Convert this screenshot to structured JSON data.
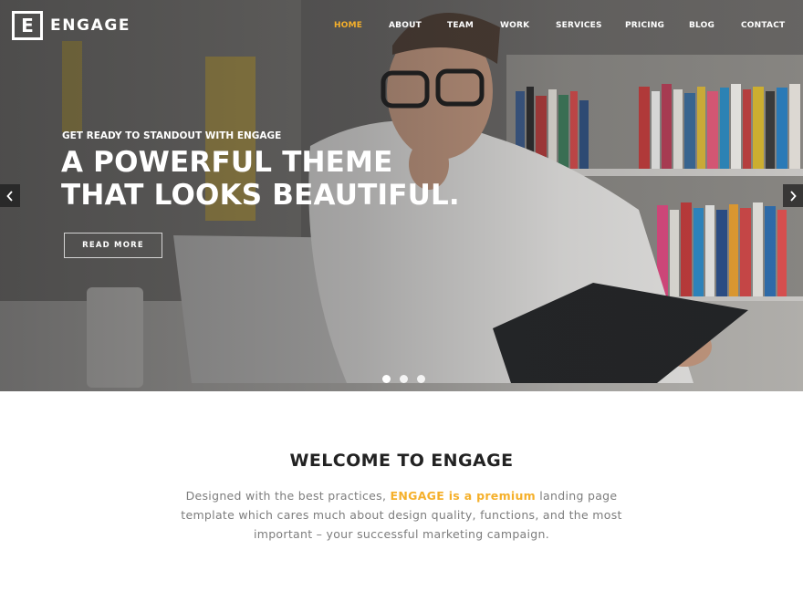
{
  "brand": {
    "logo_letter": "E",
    "name": "ENGAGE",
    "accent_color": "#f5b02b"
  },
  "nav": {
    "items": [
      {
        "label": "HOME",
        "active": true
      },
      {
        "label": "ABOUT",
        "active": false
      },
      {
        "label": "TEAM",
        "active": false
      },
      {
        "label": "WORK",
        "active": false
      },
      {
        "label": "SERVICES",
        "active": false
      },
      {
        "label": "PRICING",
        "active": false
      },
      {
        "label": "BLOG",
        "active": false
      },
      {
        "label": "CONTACT",
        "active": false
      }
    ]
  },
  "hero": {
    "eyebrow": "GET READY TO STANDOUT WITH ENGAGE",
    "headline_line1": "A POWERFUL THEME",
    "headline_line2": "THAT LOOKS BEAUTIFUL.",
    "cta_label": "READ MORE",
    "prev_icon": "chevron-left-icon",
    "next_icon": "chevron-right-icon",
    "slide_count": 3,
    "active_slide": 1
  },
  "welcome": {
    "title": "WELCOME TO ENGAGE",
    "text_before": "Designed with the best practices, ",
    "text_highlight": "ENGAGE is a premium",
    "text_after": " landing page template which cares much about design quality, functions, and the most important – your successful marketing campaign."
  }
}
